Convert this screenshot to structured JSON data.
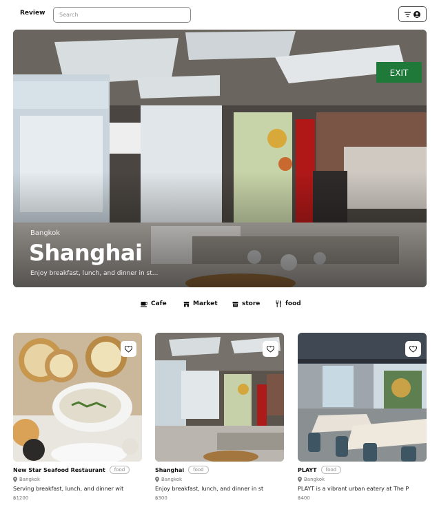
{
  "header": {
    "brand": "Review",
    "search_placeholder": "Search"
  },
  "hero": {
    "city": "Bangkok",
    "title": "Shanghai",
    "subtitle": "Enjoy breakfast, lunch, and dinner in st..."
  },
  "categories": [
    {
      "label": "Cafe",
      "icon": "coffee-cup-icon"
    },
    {
      "label": "Market",
      "icon": "market-icon"
    },
    {
      "label": "store",
      "icon": "store-icon"
    },
    {
      "label": "food",
      "icon": "fork-knife-icon"
    }
  ],
  "cards": [
    {
      "name": "New Star Seafood Restaurant",
      "tag": "food",
      "location": "Bangkok",
      "description": "Serving breakfast, lunch, and dinner wit",
      "price": "฿1200"
    },
    {
      "name": "Shanghai",
      "tag": "food",
      "location": "Bangkok",
      "description": "Enjoy breakfast, lunch, and dinner in st",
      "price": "฿300"
    },
    {
      "name": "PLAYT",
      "tag": "food",
      "location": "Bangkok",
      "description": "PLAYT is a vibrant urban eatery at The P",
      "price": "฿400"
    }
  ],
  "colors": {
    "text": "#111111",
    "muted": "#777777",
    "border": "#888888",
    "exit_sign": "#1f7a3a"
  }
}
